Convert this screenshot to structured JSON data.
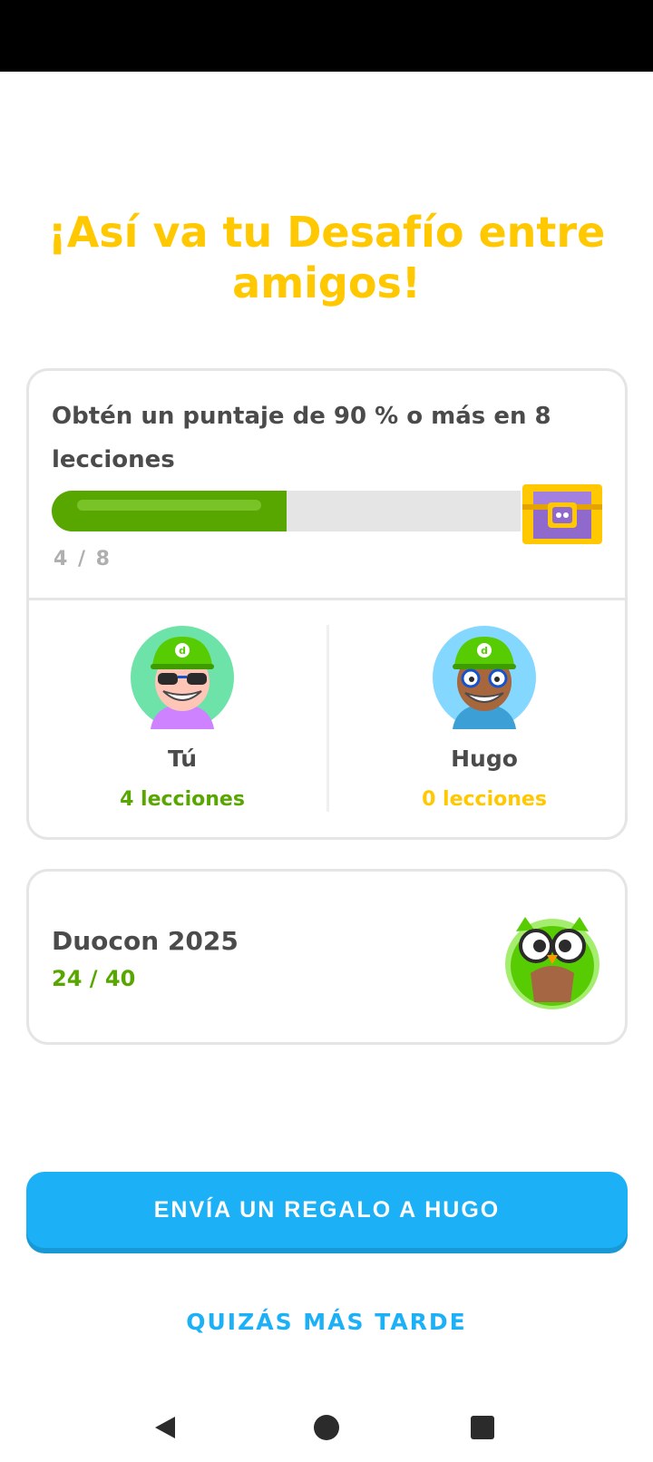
{
  "title": "¡Así va tu Desafío entre amigos!",
  "challenge": {
    "goal": "Obtén un puntaje de 90 % o más en 8 lecciones",
    "progress_text": "4 / 8",
    "progress_current": 4,
    "progress_total": 8,
    "reward_icon": "treasure-chest-icon"
  },
  "players": [
    {
      "name": "Tú",
      "lessons": "4 lecciones"
    },
    {
      "name": "Hugo",
      "lessons": "0 lecciones"
    }
  ],
  "event": {
    "title": "Duocon 2025",
    "progress": "24 / 40",
    "icon": "duo-owl-icon"
  },
  "buttons": {
    "send_gift": "ENVÍA UN REGALO A HUGO",
    "later": "QUIZÁS MÁS TARDE"
  },
  "colors": {
    "title": "#ffc800",
    "progress": "#58a700",
    "primary": "#1cb0f6"
  },
  "nav": {
    "back_icon": "back-triangle-icon",
    "home_icon": "home-circle-icon",
    "recents_icon": "recents-square-icon"
  }
}
